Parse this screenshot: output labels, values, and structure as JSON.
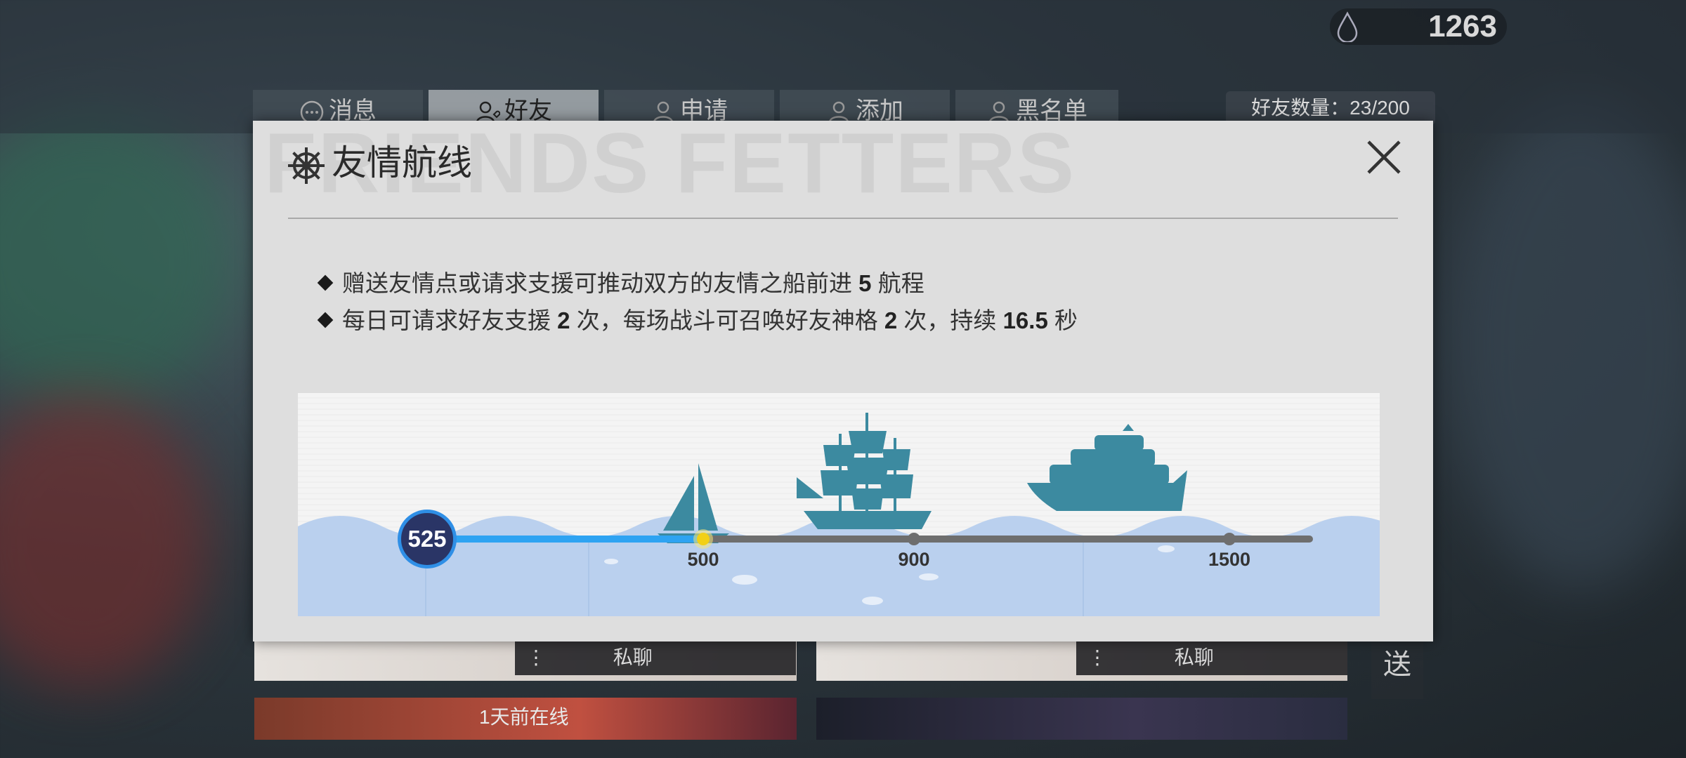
{
  "currency": {
    "icon": "water-drop-icon",
    "value": "1263"
  },
  "tabs": [
    {
      "label": "消息",
      "icon": "chat-icon",
      "active": false
    },
    {
      "label": "好友",
      "icon": "friend-icon",
      "active": true
    },
    {
      "label": "申请",
      "icon": "person-icon",
      "active": false
    },
    {
      "label": "添加",
      "icon": "person-icon",
      "active": false
    },
    {
      "label": "黑名单",
      "icon": "person-icon",
      "active": false
    }
  ],
  "friend_count": "好友数量：23/200",
  "background_cards": {
    "chat_label": "私聊",
    "online_status": "1天前在线",
    "send_label": "送"
  },
  "modal": {
    "watermark": "FRIENDS FETTERS",
    "title": "友情航线",
    "rules": [
      {
        "pre": "赠送友情点或请求支援可推动双方的友情之船前进 ",
        "b1": "5",
        "mid": " 航程",
        "b2": "",
        "mid2": "",
        "b3": "",
        "post": ""
      },
      {
        "pre": "每日可请求好友支援 ",
        "b1": "2",
        "mid": " 次，每场战斗可召唤好友神格 ",
        "b2": "2",
        "mid2": " 次，持续 ",
        "b3": "16.5",
        "post": " 秒"
      }
    ],
    "route": {
      "current": 525,
      "current_label": "525",
      "milestones": [
        {
          "value": 500,
          "label": "500",
          "ship": "sailboat-icon"
        },
        {
          "value": 900,
          "label": "900",
          "ship": "galleon-icon"
        },
        {
          "value": 1500,
          "label": "1500",
          "ship": "yacht-icon"
        }
      ],
      "colors": {
        "progress": "#2ea3f2",
        "track": "#6e6e6e",
        "water": "#b9cfec",
        "ship": "#3c8aa0",
        "marker": "#f2d016"
      }
    }
  }
}
